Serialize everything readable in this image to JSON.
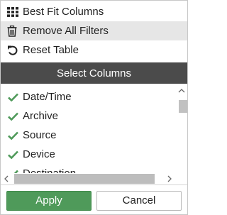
{
  "menu": {
    "items": [
      {
        "label": "Best Fit Columns",
        "icon": "grid-icon"
      },
      {
        "label": "Remove All Filters",
        "icon": "trash-icon"
      },
      {
        "label": "Reset Table",
        "icon": "undo-icon"
      }
    ]
  },
  "section": {
    "title": "Select Columns"
  },
  "columns": [
    {
      "label": "Date/Time",
      "checked": true
    },
    {
      "label": "Archive",
      "checked": true
    },
    {
      "label": "Source",
      "checked": true
    },
    {
      "label": "Device",
      "checked": true
    },
    {
      "label": "Destination",
      "checked": true
    }
  ],
  "buttons": {
    "apply": "Apply",
    "cancel": "Cancel"
  },
  "colors": {
    "header_bg": "#4b4b4b",
    "check": "#4f9a5a",
    "apply_bg": "#4f9a5a",
    "hover_bg": "#e6e6e6"
  }
}
